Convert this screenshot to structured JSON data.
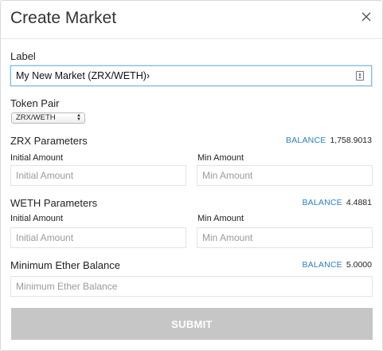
{
  "dialog": {
    "title": "Create Market"
  },
  "label_field": {
    "label": "Label",
    "value": "My New Market (ZRX/WETH)›"
  },
  "token_pair": {
    "label": "Token Pair",
    "selected": "ZRX/WETH"
  },
  "zrx": {
    "heading": "ZRX Parameters",
    "balance_label": "BALANCE",
    "balance_value": "1,758.9013",
    "initial_label": "Initial Amount",
    "initial_placeholder": "Initial Amount",
    "min_label": "Min Amount",
    "min_placeholder": "Min Amount"
  },
  "weth": {
    "heading": "WETH Parameters",
    "balance_label": "BALANCE",
    "balance_value": "4.4881",
    "initial_label": "Initial Amount",
    "initial_placeholder": "Initial Amount",
    "min_label": "Min Amount",
    "min_placeholder": "Min Amount"
  },
  "ether": {
    "heading": "Minimum Ether Balance",
    "balance_label": "BALANCE",
    "balance_value": "5.0000",
    "placeholder": "Minimum Ether Balance"
  },
  "submit": {
    "label": "SUBMIT"
  },
  "colors": {
    "accent": "#2b7fc4",
    "submit_disabled": "#c6c6c6",
    "focus_border": "#7fc1dc"
  },
  "icons": {
    "close": "close-icon",
    "field_helper": "keychain-icon",
    "select_arrows": "select-arrows-icon"
  }
}
